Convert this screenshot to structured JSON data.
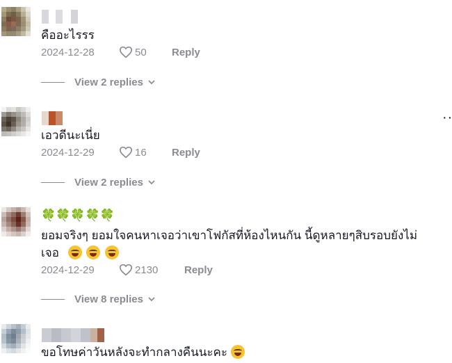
{
  "comments": [
    {
      "text": "คืออะไรรร",
      "date": "2024-12-28",
      "likes": "50",
      "reply_label": "Reply",
      "view_replies": "View 2 replies"
    },
    {
      "text": "เอวดีนะเนี่ย",
      "date": "2024-12-29",
      "likes": "16",
      "reply_label": "Reply",
      "view_replies": "View 2 replies"
    },
    {
      "emoji_row": "🍀🍀🍀🍀🍀",
      "text_line1": "ยอมจริงๆ ยอมใจคนหาเจอว่าเขาโฟกัสที่ห้องไหนกัน นี้ดูหลายๆสิบรอบยังไม่",
      "text_line2": "เจอ",
      "date": "2024-12-29",
      "likes": "2130",
      "reply_label": "Reply",
      "view_replies": "View 8 replies"
    },
    {
      "text": "ขอโทษค่าวันหลังจะทำกลางคืนนะคะ"
    }
  ],
  "more_options_label": "··"
}
